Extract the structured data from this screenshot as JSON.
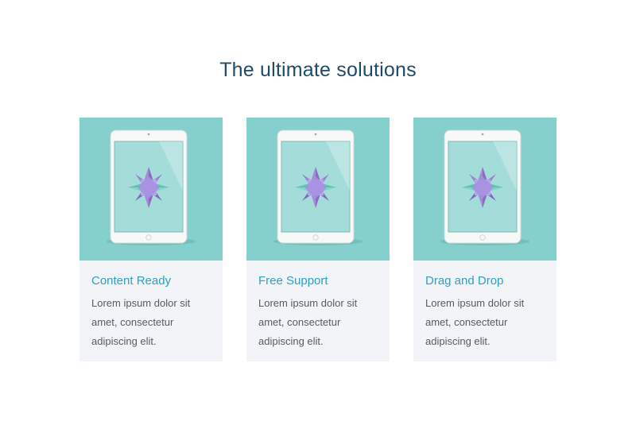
{
  "section": {
    "title": "The ultimate solutions"
  },
  "cards": [
    {
      "title": "Content Ready",
      "text": "Lorem ipsum dolor sit amet, consectetur adipiscing elit.",
      "image_icon": "tablet-icon"
    },
    {
      "title": "Free Support",
      "text": "Lorem ipsum dolor sit amet, consectetur adipiscing elit.",
      "image_icon": "tablet-icon"
    },
    {
      "title": "Drag and Drop",
      "text": "Lorem ipsum dolor sit amet, consectetur adipiscing elit.",
      "image_icon": "tablet-icon"
    }
  ],
  "colors": {
    "title": "#1f4a68",
    "card_title": "#2aa1c7",
    "image_bg": "#85d0cc",
    "card_bg": "#f2f4f8"
  }
}
